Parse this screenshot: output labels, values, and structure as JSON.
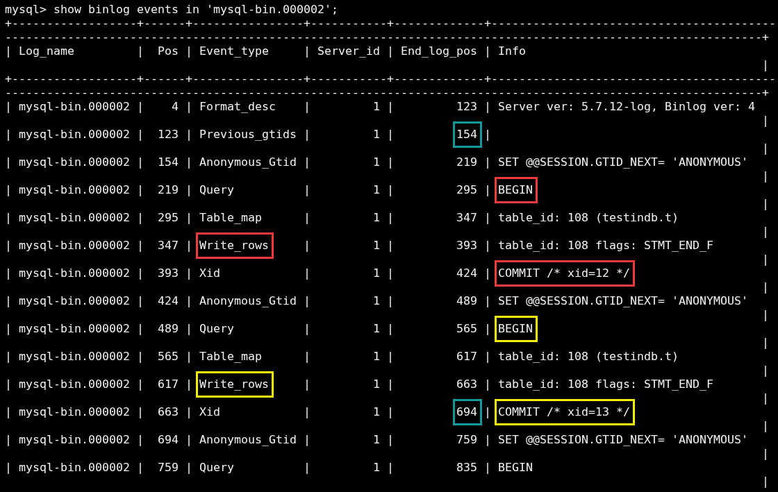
{
  "terminal": {
    "command_line": "mysql> show binlog events in 'mysql-bin.000002';",
    "border_chars": {
      "corner": "+",
      "horizontal": "-",
      "vertical": "|"
    },
    "columns": [
      "Log_name",
      "Pos",
      "Event_type",
      "Server_id",
      "End_log_pos",
      "Info"
    ],
    "rows": [
      {
        "cells": [
          {
            "text": "mysql-bin.000002"
          },
          {
            "text": "4"
          },
          {
            "text": "Format_desc"
          },
          {
            "text": "1"
          },
          {
            "text": "123"
          },
          {
            "text": "Server ver: 5.7.12-log, Binlog ver: 4"
          }
        ]
      },
      {
        "cells": [
          {
            "text": "mysql-bin.000002"
          },
          {
            "text": "123"
          },
          {
            "text": "Previous_gtids"
          },
          {
            "text": "1"
          },
          {
            "text": "154",
            "color": "#13999a"
          },
          {
            "text": ""
          }
        ]
      },
      {
        "cells": [
          {
            "text": "mysql-bin.000002"
          },
          {
            "text": "154"
          },
          {
            "text": "Anonymous_Gtid"
          },
          {
            "text": "1"
          },
          {
            "text": "219"
          },
          {
            "text": "SET @@SESSION.GTID_NEXT= 'ANONYMOUS'"
          }
        ]
      },
      {
        "cells": [
          {
            "text": "mysql-bin.000002"
          },
          {
            "text": "219"
          },
          {
            "text": "Query"
          },
          {
            "text": "1"
          },
          {
            "text": "295"
          },
          {
            "text": "BEGIN",
            "color": "#f23b3b"
          }
        ]
      },
      {
        "cells": [
          {
            "text": "mysql-bin.000002"
          },
          {
            "text": "295"
          },
          {
            "text": "Table_map"
          },
          {
            "text": "1"
          },
          {
            "text": "347"
          },
          {
            "text": "table_id: 108 (testindb.t)"
          }
        ]
      },
      {
        "cells": [
          {
            "text": "mysql-bin.000002"
          },
          {
            "text": "347"
          },
          {
            "text": "Write_rows",
            "color": "#f23b3b"
          },
          {
            "text": "1"
          },
          {
            "text": "393"
          },
          {
            "text": "table_id: 108 flags: STMT_END_F"
          }
        ]
      },
      {
        "cells": [
          {
            "text": "mysql-bin.000002"
          },
          {
            "text": "393"
          },
          {
            "text": "Xid"
          },
          {
            "text": "1"
          },
          {
            "text": "424"
          },
          {
            "text": "COMMIT /* xid=12 */",
            "color": "#f23b3b"
          }
        ]
      },
      {
        "cells": [
          {
            "text": "mysql-bin.000002"
          },
          {
            "text": "424"
          },
          {
            "text": "Anonymous_Gtid"
          },
          {
            "text": "1"
          },
          {
            "text": "489"
          },
          {
            "text": "SET @@SESSION.GTID_NEXT= 'ANONYMOUS'"
          }
        ]
      },
      {
        "cells": [
          {
            "text": "mysql-bin.000002"
          },
          {
            "text": "489"
          },
          {
            "text": "Query"
          },
          {
            "text": "1"
          },
          {
            "text": "565"
          },
          {
            "text": "BEGIN",
            "color": "#f5f000"
          }
        ]
      },
      {
        "cells": [
          {
            "text": "mysql-bin.000002"
          },
          {
            "text": "565"
          },
          {
            "text": "Table_map"
          },
          {
            "text": "1"
          },
          {
            "text": "617"
          },
          {
            "text": "table_id: 108 (testindb.t)"
          }
        ]
      },
      {
        "cells": [
          {
            "text": "mysql-bin.000002"
          },
          {
            "text": "617"
          },
          {
            "text": "Write_rows",
            "color": "#f5f000"
          },
          {
            "text": "1"
          },
          {
            "text": "663"
          },
          {
            "text": "table_id: 108 flags: STMT_END_F"
          }
        ]
      },
      {
        "cells": [
          {
            "text": "mysql-bin.000002"
          },
          {
            "text": "663"
          },
          {
            "text": "Xid"
          },
          {
            "text": "1"
          },
          {
            "text": "694",
            "color": "#13999a"
          },
          {
            "text": "COMMIT /* xid=13 */",
            "color": "#f5f000"
          }
        ]
      },
      {
        "cells": [
          {
            "text": "mysql-bin.000002"
          },
          {
            "text": "694"
          },
          {
            "text": "Anonymous_Gtid"
          },
          {
            "text": "1"
          },
          {
            "text": "759"
          },
          {
            "text": "SET @@SESSION.GTID_NEXT= 'ANONYMOUS'"
          }
        ]
      },
      {
        "cells": [
          {
            "text": "mysql-bin.000002"
          },
          {
            "text": "759"
          },
          {
            "text": "Query"
          },
          {
            "text": "1"
          },
          {
            "text": "835"
          },
          {
            "text": "BEGIN"
          }
        ]
      }
    ]
  }
}
